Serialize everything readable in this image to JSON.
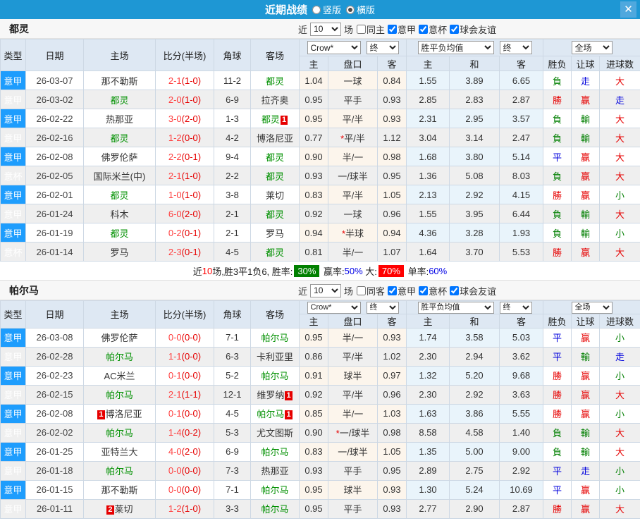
{
  "titlebar": {
    "title": "近期战绩",
    "radio_vertical": "竖版",
    "radio_horizontal": "横版",
    "close_label": "✕"
  },
  "colors": {
    "accent": "#1e97d4",
    "league_serie_a": "#1e9dfd",
    "league_coppa": "#4653e3",
    "win": "#e60000",
    "lose": "#007f00",
    "draw": "#0000dd",
    "team_highlight": "#009000",
    "summary_win_badge": "#008000",
    "summary_big_badge": "#ff0000"
  },
  "filter_labels": {
    "near": "近",
    "count": "10",
    "games": "场"
  },
  "table": {
    "headers": [
      "类型",
      "日期",
      "主场",
      "比分(半场)",
      "角球",
      "客场",
      "主",
      "盘口",
      "客",
      "主",
      "和",
      "客",
      "胜负",
      "让球",
      "进球数"
    ],
    "dropdowns": {
      "bookmaker": "Crow*",
      "final": "终",
      "avg": "胜平负均值",
      "scope": "全场"
    }
  },
  "sections": [
    {
      "team": "都灵",
      "filters": [
        {
          "key": "same-home",
          "label": "同主",
          "checked": false
        },
        {
          "key": "serie-a",
          "label": "意甲",
          "checked": true
        },
        {
          "key": "coppa-italia",
          "label": "意杯",
          "checked": true
        },
        {
          "key": "club-friendly",
          "label": "球会友谊",
          "checked": true
        }
      ],
      "rows": [
        {
          "type": "意甲",
          "league": "jia",
          "date": "26-03-07",
          "home": {
            "name": "那不勒斯"
          },
          "score": "2-1",
          "half": "(1-0)",
          "corners": "11-2",
          "away": {
            "name": "都灵",
            "green": true
          },
          "odds": [
            "1.04",
            "一球",
            "0.84"
          ],
          "avg": [
            "1.55",
            "3.89",
            "6.65"
          ],
          "results": [
            [
              "負",
              "g"
            ],
            [
              "走",
              "b"
            ],
            [
              "大",
              "r"
            ]
          ]
        },
        {
          "type": "意甲",
          "league": "jia",
          "date": "26-03-02",
          "home": {
            "name": "都灵",
            "green": true
          },
          "score": "2-0",
          "half": "(1-0)",
          "corners": "6-9",
          "away": {
            "name": "拉齐奥"
          },
          "odds": [
            "0.95",
            "平手",
            "0.93"
          ],
          "avg": [
            "2.85",
            "2.83",
            "2.87"
          ],
          "results": [
            [
              "勝",
              "r"
            ],
            [
              "赢",
              "r"
            ],
            [
              "走",
              "b"
            ]
          ]
        },
        {
          "type": "意甲",
          "league": "jia",
          "date": "26-02-22",
          "home": {
            "name": "热那亚"
          },
          "score": "3-0",
          "half": "(2-0)",
          "corners": "1-3",
          "away": {
            "name": "都灵",
            "green": true,
            "badge": "1",
            "badge_pos": "after"
          },
          "odds": [
            "0.95",
            "平/半",
            "0.93"
          ],
          "avg": [
            "2.31",
            "2.95",
            "3.57"
          ],
          "results": [
            [
              "負",
              "g"
            ],
            [
              "輸",
              "g"
            ],
            [
              "大",
              "r"
            ]
          ]
        },
        {
          "type": "意甲",
          "league": "jia",
          "date": "26-02-16",
          "home": {
            "name": "都灵",
            "green": true
          },
          "score": "1-2",
          "half": "(0-0)",
          "corners": "4-2",
          "away": {
            "name": "博洛尼亚"
          },
          "odds": [
            "0.77",
            "*平/半",
            "1.12"
          ],
          "avg": [
            "3.04",
            "3.14",
            "2.47"
          ],
          "results": [
            [
              "負",
              "g"
            ],
            [
              "輸",
              "g"
            ],
            [
              "大",
              "r"
            ]
          ]
        },
        {
          "type": "意甲",
          "league": "jia",
          "date": "26-02-08",
          "home": {
            "name": "佛罗伦萨"
          },
          "score": "2-2",
          "half": "(0-1)",
          "corners": "9-4",
          "away": {
            "name": "都灵",
            "green": true
          },
          "odds": [
            "0.90",
            "半/一",
            "0.98"
          ],
          "avg": [
            "1.68",
            "3.80",
            "5.14"
          ],
          "results": [
            [
              "平",
              "b"
            ],
            [
              "赢",
              "r"
            ],
            [
              "大",
              "r"
            ]
          ]
        },
        {
          "type": "意杯",
          "league": "bei",
          "date": "26-02-05",
          "home": {
            "name": "国际米兰(中)"
          },
          "score": "2-1",
          "half": "(1-0)",
          "corners": "2-2",
          "away": {
            "name": "都灵",
            "green": true
          },
          "odds": [
            "0.93",
            "一/球半",
            "0.95"
          ],
          "avg": [
            "1.36",
            "5.08",
            "8.03"
          ],
          "results": [
            [
              "負",
              "g"
            ],
            [
              "赢",
              "r"
            ],
            [
              "大",
              "r"
            ]
          ]
        },
        {
          "type": "意甲",
          "league": "jia",
          "date": "26-02-01",
          "home": {
            "name": "都灵",
            "green": true
          },
          "score": "1-0",
          "half": "(1-0)",
          "corners": "3-8",
          "away": {
            "name": "莱切"
          },
          "odds": [
            "0.83",
            "平/半",
            "1.05"
          ],
          "avg": [
            "2.13",
            "2.92",
            "4.15"
          ],
          "results": [
            [
              "勝",
              "r"
            ],
            [
              "赢",
              "r"
            ],
            [
              "小",
              "g"
            ]
          ]
        },
        {
          "type": "意甲",
          "league": "jia",
          "date": "26-01-24",
          "home": {
            "name": "科木"
          },
          "score": "6-0",
          "half": "(2-0)",
          "corners": "2-1",
          "away": {
            "name": "都灵",
            "green": true
          },
          "odds": [
            "0.92",
            "一球",
            "0.96"
          ],
          "avg": [
            "1.55",
            "3.95",
            "6.44"
          ],
          "results": [
            [
              "負",
              "g"
            ],
            [
              "輸",
              "g"
            ],
            [
              "大",
              "r"
            ]
          ]
        },
        {
          "type": "意甲",
          "league": "jia",
          "date": "26-01-19",
          "home": {
            "name": "都灵",
            "green": true
          },
          "score": "0-2",
          "half": "(0-1)",
          "corners": "2-1",
          "away": {
            "name": "罗马"
          },
          "odds": [
            "0.94",
            "*半球",
            "0.94"
          ],
          "avg": [
            "4.36",
            "3.28",
            "1.93"
          ],
          "results": [
            [
              "負",
              "g"
            ],
            [
              "輸",
              "g"
            ],
            [
              "小",
              "g"
            ]
          ]
        },
        {
          "type": "意杯",
          "league": "bei",
          "date": "26-01-14",
          "home": {
            "name": "罗马"
          },
          "score": "2-3",
          "half": "(0-1)",
          "corners": "4-5",
          "away": {
            "name": "都灵",
            "green": true
          },
          "odds": [
            "0.81",
            "半/一",
            "1.07"
          ],
          "avg": [
            "1.64",
            "3.70",
            "5.53"
          ],
          "results": [
            [
              "勝",
              "r"
            ],
            [
              "赢",
              "r"
            ],
            [
              "大",
              "r"
            ]
          ]
        }
      ],
      "summary": {
        "parts": [
          {
            "name": "summary-near",
            "text": "近"
          },
          {
            "name": "summary-count",
            "text": "10",
            "style": "red"
          },
          {
            "name": "summary-record",
            "text": "场,胜3平1负6, 胜率:"
          },
          {
            "name": "summary-win-rate",
            "text": "30%",
            "style": "badge-green"
          },
          {
            "name": "summary-cover-label",
            "text": " 赢率:"
          },
          {
            "name": "summary-cover-rate",
            "text": "50%",
            "style": "blue"
          },
          {
            "name": "summary-big-label",
            "text": " 大:"
          },
          {
            "name": "summary-big-rate",
            "text": "70%",
            "style": "badge-red"
          },
          {
            "name": "summary-single-label",
            "text": " 单率:"
          },
          {
            "name": "summary-single-rate",
            "text": "60%",
            "style": "blue"
          }
        ]
      }
    },
    {
      "team": "帕尔马",
      "filters": [
        {
          "key": "same-away",
          "label": "同客",
          "checked": false
        },
        {
          "key": "serie-a",
          "label": "意甲",
          "checked": true
        },
        {
          "key": "coppa-italia",
          "label": "意杯",
          "checked": true
        },
        {
          "key": "club-friendly",
          "label": "球会友谊",
          "checked": true
        }
      ],
      "rows": [
        {
          "type": "意甲",
          "league": "jia",
          "date": "26-03-08",
          "home": {
            "name": "佛罗伦萨"
          },
          "score": "0-0",
          "half": "(0-0)",
          "corners": "7-1",
          "away": {
            "name": "帕尔马",
            "green": true
          },
          "odds": [
            "0.95",
            "半/一",
            "0.93"
          ],
          "avg": [
            "1.74",
            "3.58",
            "5.03"
          ],
          "results": [
            [
              "平",
              "b"
            ],
            [
              "赢",
              "r"
            ],
            [
              "小",
              "g"
            ]
          ]
        },
        {
          "type": "意甲",
          "league": "jia",
          "date": "26-02-28",
          "home": {
            "name": "帕尔马",
            "green": true
          },
          "score": "1-1",
          "half": "(0-0)",
          "corners": "6-3",
          "away": {
            "name": "卡利亚里"
          },
          "odds": [
            "0.86",
            "平/半",
            "1.02"
          ],
          "avg": [
            "2.30",
            "2.94",
            "3.62"
          ],
          "results": [
            [
              "平",
              "b"
            ],
            [
              "輸",
              "g"
            ],
            [
              "走",
              "b"
            ]
          ]
        },
        {
          "type": "意甲",
          "league": "jia",
          "date": "26-02-23",
          "home": {
            "name": "AC米兰"
          },
          "score": "0-1",
          "half": "(0-0)",
          "corners": "5-2",
          "away": {
            "name": "帕尔马",
            "green": true
          },
          "odds": [
            "0.91",
            "球半",
            "0.97"
          ],
          "avg": [
            "1.32",
            "5.20",
            "9.68"
          ],
          "results": [
            [
              "勝",
              "r"
            ],
            [
              "赢",
              "r"
            ],
            [
              "小",
              "g"
            ]
          ]
        },
        {
          "type": "意甲",
          "league": "jia",
          "date": "26-02-15",
          "home": {
            "name": "帕尔马",
            "green": true
          },
          "score": "2-1",
          "half": "(1-1)",
          "corners": "12-1",
          "away": {
            "name": "维罗纳",
            "badge": "1",
            "badge_pos": "after"
          },
          "odds": [
            "0.92",
            "平/半",
            "0.96"
          ],
          "avg": [
            "2.30",
            "2.92",
            "3.63"
          ],
          "results": [
            [
              "勝",
              "r"
            ],
            [
              "赢",
              "r"
            ],
            [
              "大",
              "r"
            ]
          ]
        },
        {
          "type": "意甲",
          "league": "jia",
          "date": "26-02-08",
          "home": {
            "name": "博洛尼亚",
            "badge": "1",
            "badge_pos": "before"
          },
          "score": "0-1",
          "half": "(0-0)",
          "corners": "4-5",
          "away": {
            "name": "帕尔马",
            "green": true,
            "badge": "1",
            "badge_pos": "after"
          },
          "odds": [
            "0.85",
            "半/一",
            "1.03"
          ],
          "avg": [
            "1.63",
            "3.86",
            "5.55"
          ],
          "results": [
            [
              "勝",
              "r"
            ],
            [
              "赢",
              "r"
            ],
            [
              "小",
              "g"
            ]
          ]
        },
        {
          "type": "意甲",
          "league": "jia",
          "date": "26-02-02",
          "home": {
            "name": "帕尔马",
            "green": true
          },
          "score": "1-4",
          "half": "(0-2)",
          "corners": "5-3",
          "away": {
            "name": "尤文图斯"
          },
          "odds": [
            "0.90",
            "*一/球半",
            "0.98"
          ],
          "avg": [
            "8.58",
            "4.58",
            "1.40"
          ],
          "results": [
            [
              "負",
              "g"
            ],
            [
              "輸",
              "g"
            ],
            [
              "大",
              "r"
            ]
          ]
        },
        {
          "type": "意甲",
          "league": "jia",
          "date": "26-01-25",
          "home": {
            "name": "亚特兰大"
          },
          "score": "4-0",
          "half": "(2-0)",
          "corners": "6-9",
          "away": {
            "name": "帕尔马",
            "green": true
          },
          "odds": [
            "0.83",
            "一/球半",
            "1.05"
          ],
          "avg": [
            "1.35",
            "5.00",
            "9.00"
          ],
          "results": [
            [
              "負",
              "g"
            ],
            [
              "輸",
              "g"
            ],
            [
              "大",
              "r"
            ]
          ]
        },
        {
          "type": "意甲",
          "league": "jia",
          "date": "26-01-18",
          "home": {
            "name": "帕尔马",
            "green": true
          },
          "score": "0-0",
          "half": "(0-0)",
          "corners": "7-3",
          "away": {
            "name": "热那亚"
          },
          "odds": [
            "0.93",
            "平手",
            "0.95"
          ],
          "avg": [
            "2.89",
            "2.75",
            "2.92"
          ],
          "results": [
            [
              "平",
              "b"
            ],
            [
              "走",
              "b"
            ],
            [
              "小",
              "g"
            ]
          ]
        },
        {
          "type": "意甲",
          "league": "jia",
          "date": "26-01-15",
          "home": {
            "name": "那不勒斯"
          },
          "score": "0-0",
          "half": "(0-0)",
          "corners": "7-1",
          "away": {
            "name": "帕尔马",
            "green": true
          },
          "odds": [
            "0.95",
            "球半",
            "0.93"
          ],
          "avg": [
            "1.30",
            "5.24",
            "10.69"
          ],
          "results": [
            [
              "平",
              "b"
            ],
            [
              "赢",
              "r"
            ],
            [
              "小",
              "g"
            ]
          ]
        },
        {
          "type": "意甲",
          "league": "jia",
          "date": "26-01-11",
          "home": {
            "name": "莱切",
            "badge": "2",
            "badge_pos": "before"
          },
          "score": "1-2",
          "half": "(1-0)",
          "corners": "3-3",
          "away": {
            "name": "帕尔马",
            "green": true
          },
          "odds": [
            "0.95",
            "平手",
            "0.93"
          ],
          "avg": [
            "2.77",
            "2.90",
            "2.87"
          ],
          "results": [
            [
              "勝",
              "r"
            ],
            [
              "赢",
              "r"
            ],
            [
              "大",
              "r"
            ]
          ]
        }
      ]
    }
  ]
}
